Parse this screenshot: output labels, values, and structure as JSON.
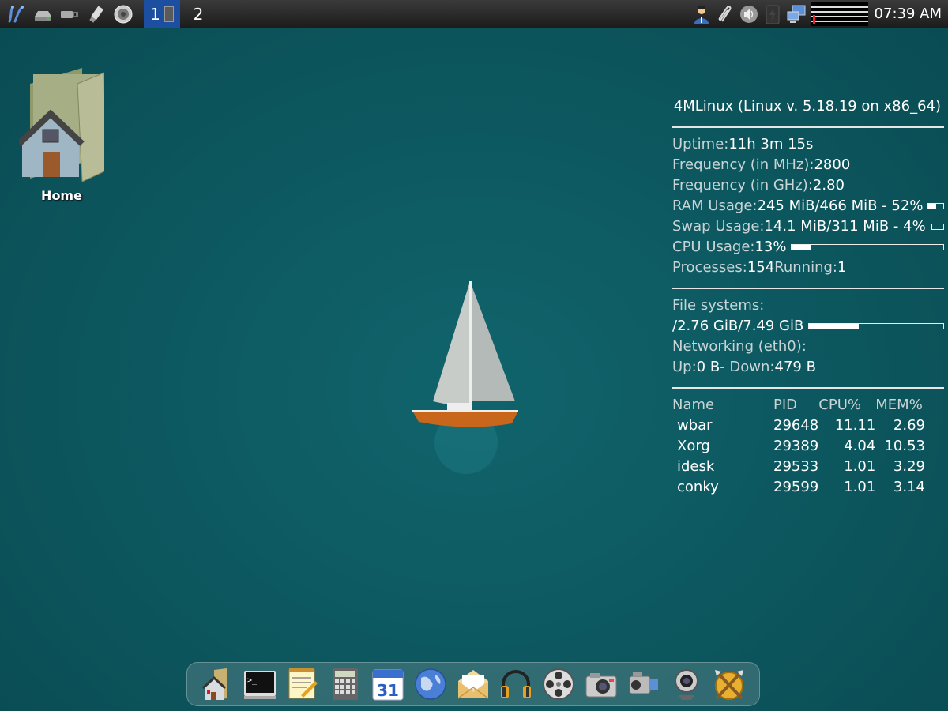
{
  "top_panel": {
    "launchers": [
      "menu-icon",
      "drive-icon",
      "usb-icon",
      "flash-drive-icon",
      "speaker-icon"
    ],
    "workspaces": [
      {
        "label": "1",
        "active": true
      },
      {
        "label": "2",
        "active": false
      }
    ],
    "tray": [
      "user-icon",
      "paperclip-icon",
      "volume-icon",
      "battery-icon",
      "network-icon"
    ],
    "clock": "07:39 AM"
  },
  "desktop": {
    "home_label": "Home"
  },
  "conky": {
    "title": "4MLinux (Linux v. 5.18.19 on x86_64)",
    "uptime_label": "Uptime:",
    "uptime_value": "11h 3m 15s",
    "freq_mhz_label": "Frequency (in MHz):",
    "freq_mhz_value": "2800",
    "freq_ghz_label": "Frequency (in GHz):",
    "freq_ghz_value": "2.80",
    "ram_label": "RAM Usage:",
    "ram_value": "245 MiB/466 MiB - 52%",
    "ram_percent": 52,
    "swap_label": "Swap Usage:",
    "swap_value": "14.1 MiB/311 MiB - 4%",
    "swap_percent": 4,
    "cpu_label": "CPU Usage:",
    "cpu_value": "13%",
    "cpu_percent": 13,
    "processes_label": "Processes:",
    "processes_value": "154",
    "running_label": "Running:",
    "running_value": "1",
    "fs_label": "File systems:",
    "fs_root_label": "/",
    "fs_root_value": "2.76 GiB/7.49 GiB",
    "fs_root_percent": 37,
    "net_label": "Networking (eth0):",
    "up_label": "Up:",
    "up_value": "0 B",
    "down_label": "- Down:",
    "down_value": "479 B",
    "table_headers": [
      "Name",
      "PID",
      "CPU%",
      "MEM%"
    ],
    "processes": [
      {
        "name": "wbar",
        "pid": "29648",
        "cpu": "11.11",
        "mem": "2.69"
      },
      {
        "name": "Xorg",
        "pid": "29389",
        "cpu": "4.04",
        "mem": "10.53"
      },
      {
        "name": "idesk",
        "pid": "29533",
        "cpu": "1.01",
        "mem": "3.29"
      },
      {
        "name": "conky",
        "pid": "29599",
        "cpu": "1.01",
        "mem": "3.14"
      }
    ]
  },
  "dock": {
    "items": [
      "home-folder-icon",
      "terminal-icon",
      "text-editor-icon",
      "calculator-icon",
      "calendar-icon",
      "web-browser-icon",
      "mail-icon",
      "headphones-icon",
      "video-player-icon",
      "camera-icon",
      "camcorder-icon",
      "webcam-icon",
      "games-icon"
    ],
    "calendar_day": "31"
  }
}
